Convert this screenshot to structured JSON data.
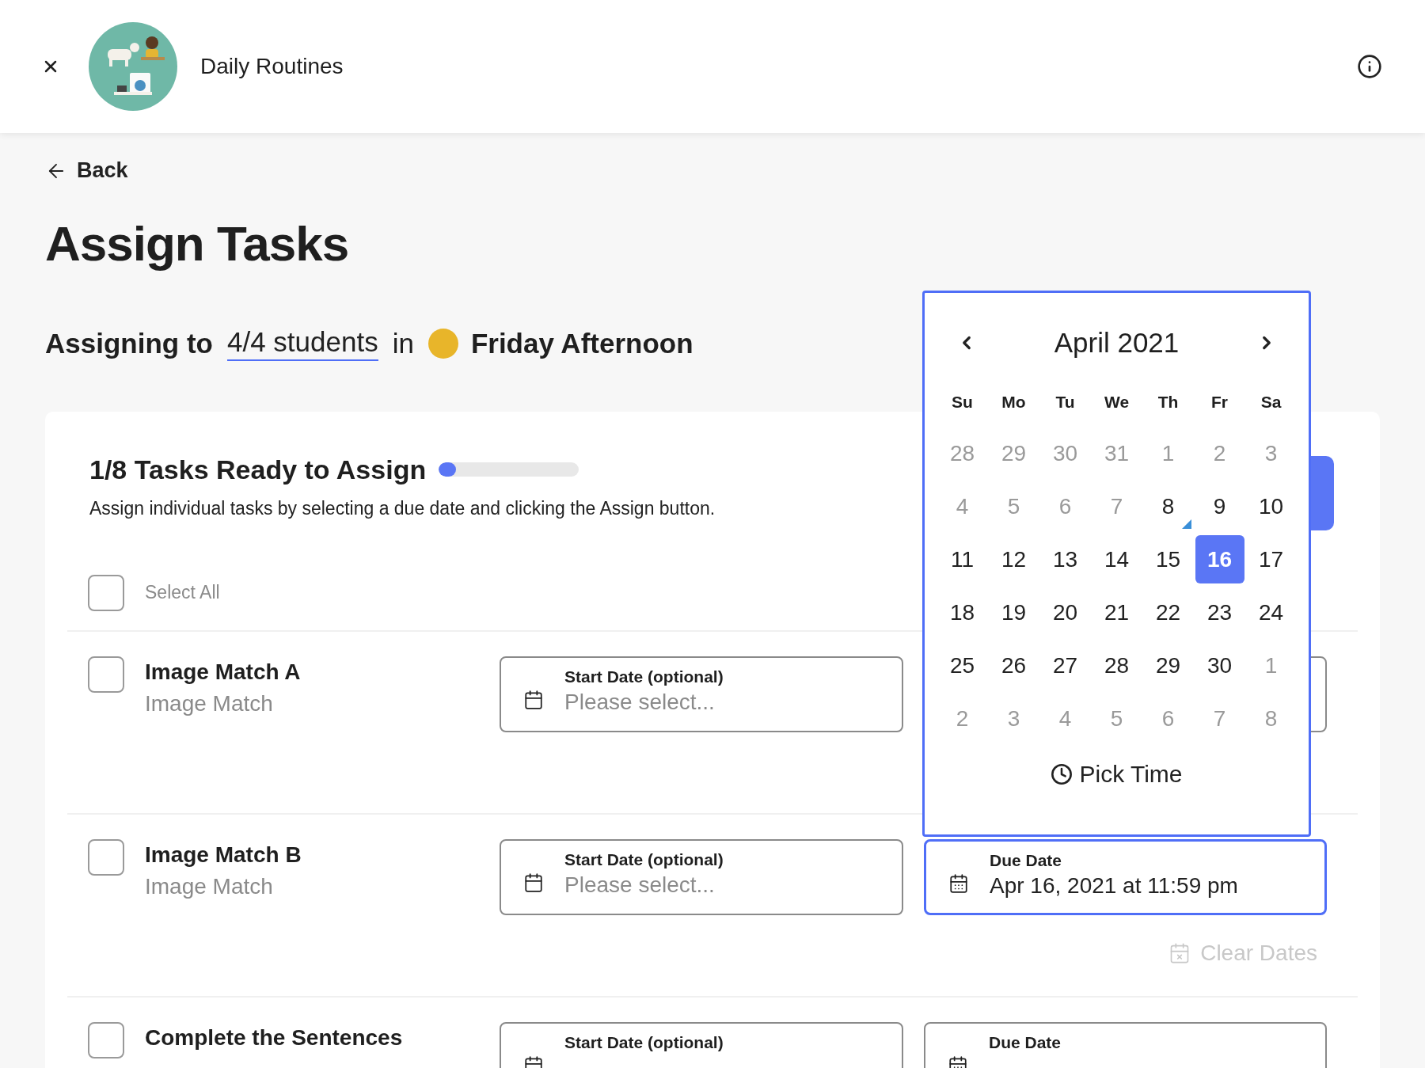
{
  "header": {
    "title": "Daily Routines"
  },
  "back": "Back",
  "page_title": "Assign Tasks",
  "assigning": {
    "prefix": "Assigning to",
    "students": "4/4 students",
    "connector": "in",
    "class_name": "Friday Afternoon"
  },
  "card": {
    "title": "1/8 Tasks Ready to Assign",
    "progress": {
      "level": 0.125
    },
    "description": "Assign individual tasks by selecting a due date and clicking the Assign button.",
    "select_all": {
      "label": "Select All",
      "checked": false
    }
  },
  "tasks": [
    {
      "title": "Image Match A",
      "type": "Image Match",
      "checked": false,
      "start_date": {
        "label": "Start Date (optional)",
        "placeholder": "Please select..."
      }
    },
    {
      "title": "Image Match B",
      "type": "Image Match",
      "checked": false,
      "start_date": {
        "label": "Start Date (optional)",
        "placeholder": "Please select..."
      },
      "due_date": {
        "label": "Due Date",
        "value": "Apr 16, 2021 at 11:59 pm",
        "focused": true
      },
      "clear_dates": {
        "label": "Clear Dates",
        "disabled": true
      }
    },
    {
      "title": "Complete the Sentences",
      "checked": false,
      "start_date": {
        "label": "Start Date (optional)"
      },
      "due_date": {
        "label": "Due Date",
        "focused": false
      }
    }
  ],
  "calendar": {
    "month": "April 2021",
    "weekdays": [
      "Su",
      "Mo",
      "Tu",
      "We",
      "Th",
      "Fr",
      "Sa"
    ],
    "weeks": [
      [
        {
          "day": "28",
          "outside": true
        },
        {
          "day": "29",
          "outside": true
        },
        {
          "day": "30",
          "outside": true
        },
        {
          "day": "31",
          "outside": true
        },
        {
          "day": "1",
          "outside": true
        },
        {
          "day": "2",
          "outside": true
        },
        {
          "day": "3",
          "outside": true
        }
      ],
      [
        {
          "day": "4",
          "outside": true
        },
        {
          "day": "5",
          "outside": true
        },
        {
          "day": "6",
          "outside": true
        },
        {
          "day": "7",
          "outside": true
        },
        {
          "day": "8",
          "outside": false,
          "today": true
        },
        {
          "day": "9",
          "outside": false
        },
        {
          "day": "10",
          "outside": false
        }
      ],
      [
        {
          "day": "11",
          "outside": false
        },
        {
          "day": "12",
          "outside": false
        },
        {
          "day": "13",
          "outside": false
        },
        {
          "day": "14",
          "outside": false
        },
        {
          "day": "15",
          "outside": false
        },
        {
          "day": "16",
          "outside": false,
          "selected": true
        },
        {
          "day": "17",
          "outside": false
        }
      ],
      [
        {
          "day": "18",
          "outside": false
        },
        {
          "day": "19",
          "outside": false
        },
        {
          "day": "20",
          "outside": false
        },
        {
          "day": "21",
          "outside": false
        },
        {
          "day": "22",
          "outside": false
        },
        {
          "day": "23",
          "outside": false
        },
        {
          "day": "24",
          "outside": false
        }
      ],
      [
        {
          "day": "25",
          "outside": false
        },
        {
          "day": "26",
          "outside": false
        },
        {
          "day": "27",
          "outside": false
        },
        {
          "day": "28",
          "outside": false
        },
        {
          "day": "29",
          "outside": false
        },
        {
          "day": "30",
          "outside": false
        },
        {
          "day": "1",
          "outside": true
        }
      ],
      [
        {
          "day": "2",
          "outside": true
        },
        {
          "day": "3",
          "outside": true
        },
        {
          "day": "4",
          "outside": true
        },
        {
          "day": "5",
          "outside": true
        },
        {
          "day": "6",
          "outside": true
        },
        {
          "day": "7",
          "outside": true
        },
        {
          "day": "8",
          "outside": true
        }
      ]
    ],
    "pick_time": "Pick Time"
  }
}
